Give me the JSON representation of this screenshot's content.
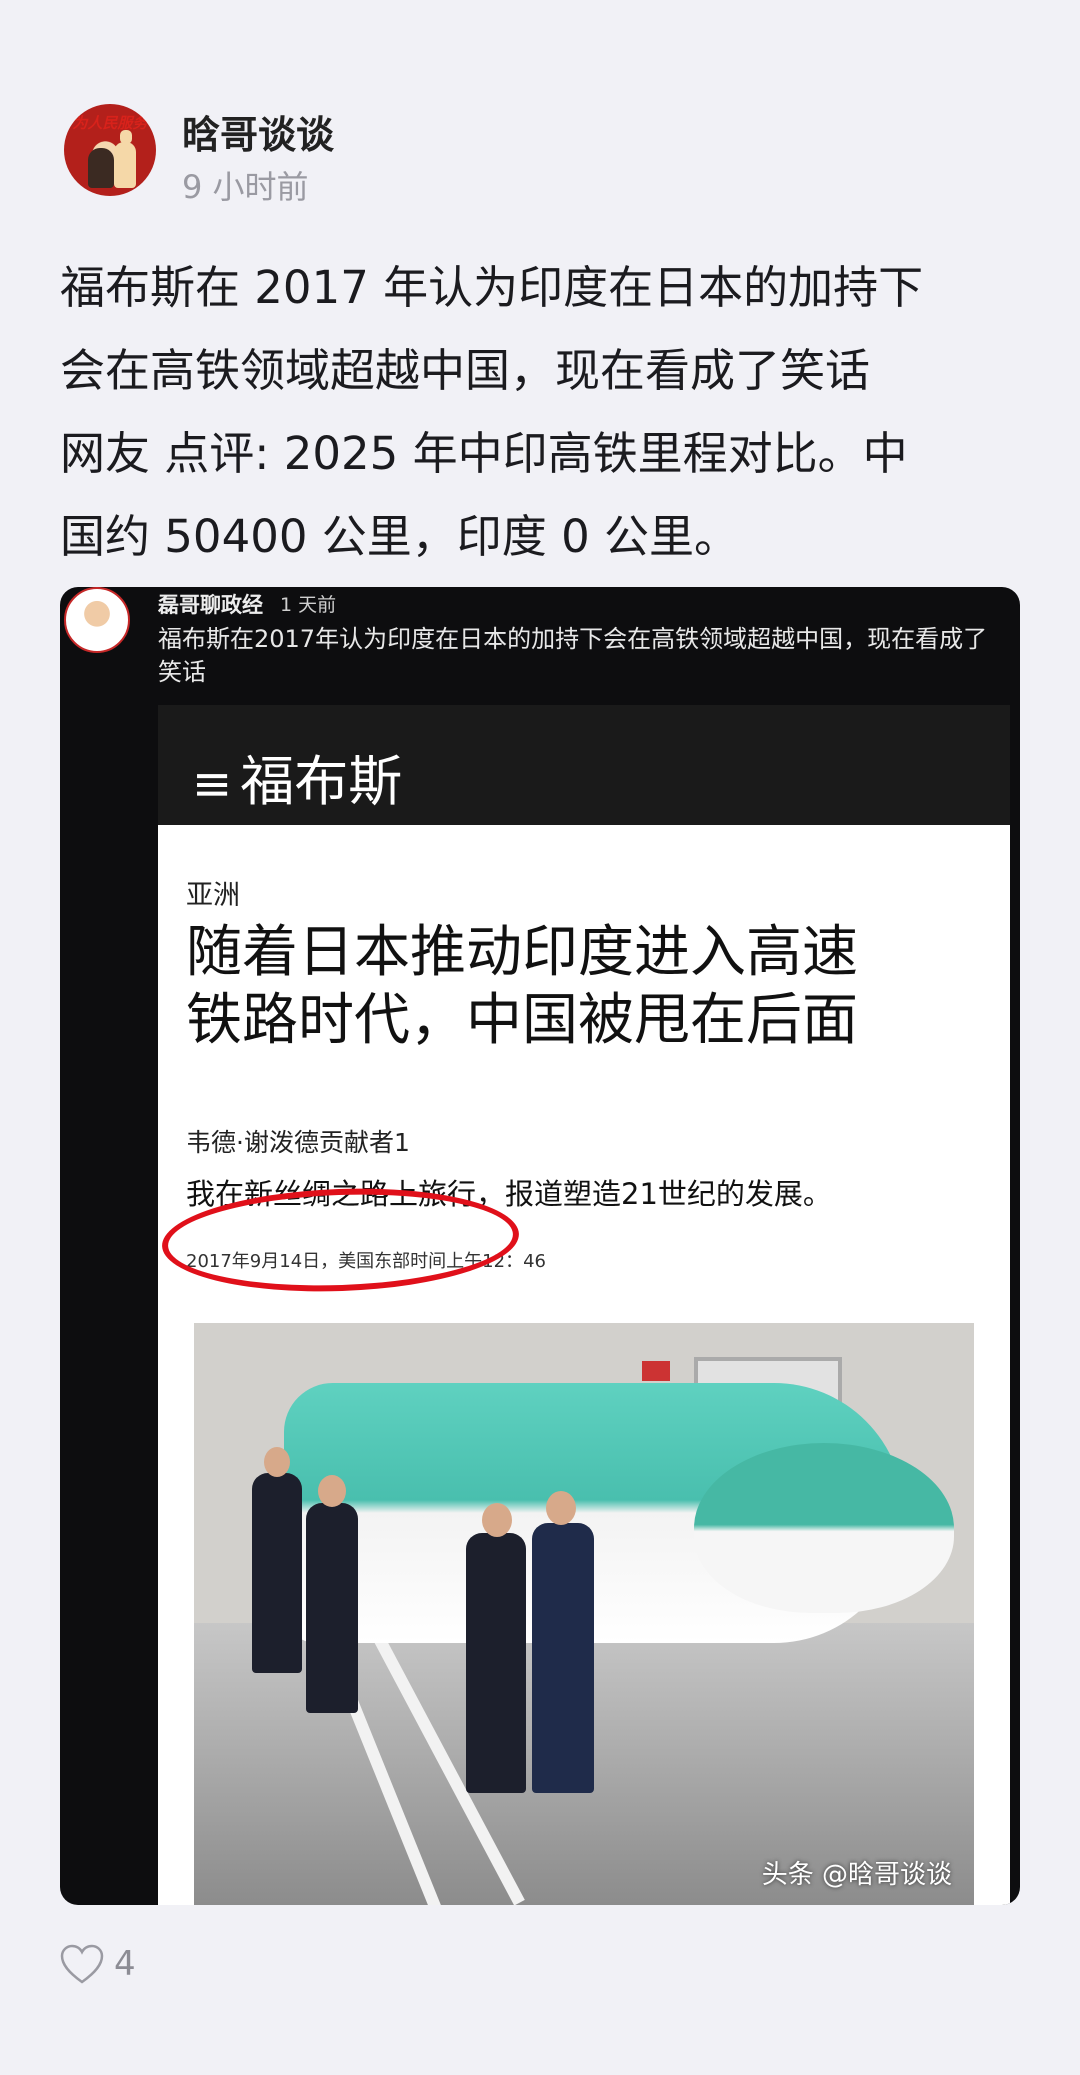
{
  "post": {
    "author": "晗哥谈谈",
    "time": "9 小时前",
    "avatar_text": "为人民服务",
    "lines": [
      "福布斯在 2017 年认为印度在日本的加持下",
      "会在高铁领域超越中国，现在看成了笑话",
      "网友 点评: 2025 年中印高铁里程对比。中",
      "国约 50400 公里，印度 0 公里。"
    ]
  },
  "embedded": {
    "author": "磊哥聊政经",
    "time": "1 天前",
    "caption": "福布斯在2017年认为印度在日本的加持下会在高铁领域超越中国，现在看成了笑话"
  },
  "article": {
    "logo": "福布斯",
    "menu_icon": "≡",
    "section": "亚洲",
    "headline_lines": [
      "随着日本推动印度进入高速",
      "铁路时代，中国被甩在后面"
    ],
    "author": "韦德·谢泼德贡献者1",
    "bio": "我在新丝绸之路上旅行，报道塑造21世纪的发展。",
    "date": "2017年9月14日，美国东部时间上午12：46"
  },
  "watermark": "头条 @晗哥谈谈",
  "footer": {
    "likes": "4",
    "icon": "heart-icon"
  },
  "colors": {
    "background": "#f1f1f6",
    "media_bg": "#0d0d0f",
    "circle": "#e0101a",
    "train": "#49bfae"
  }
}
